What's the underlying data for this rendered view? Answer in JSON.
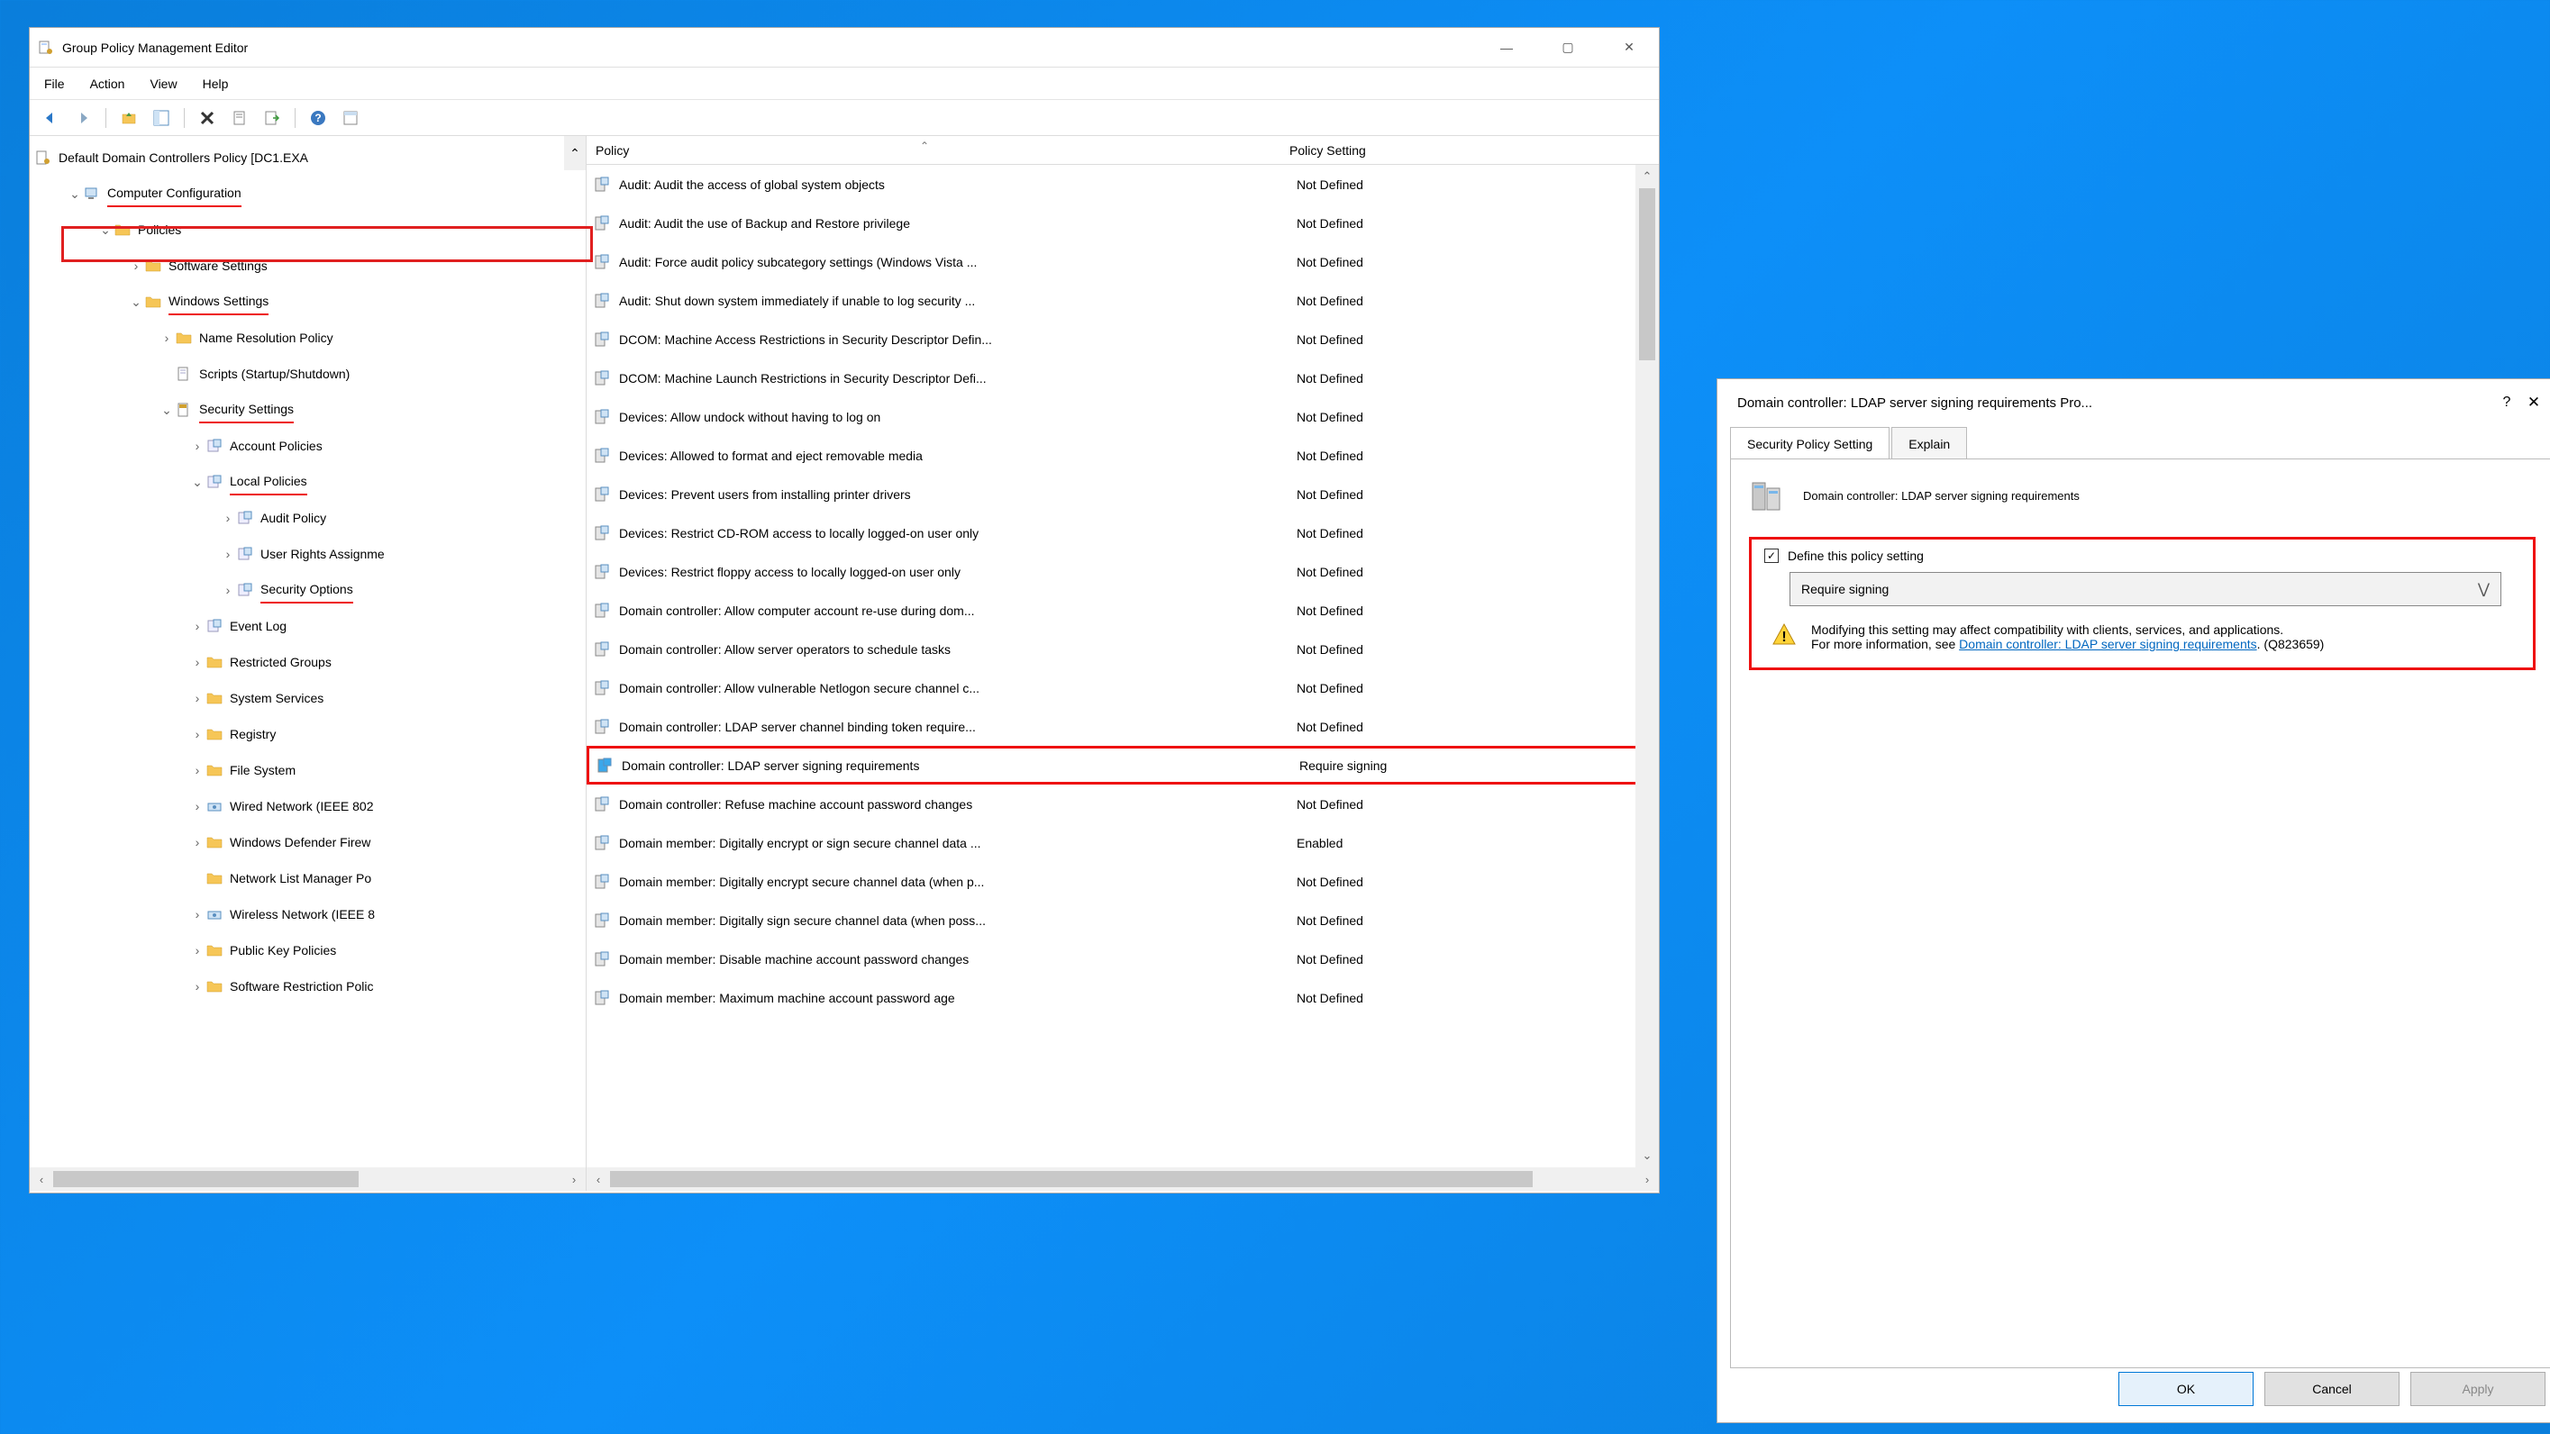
{
  "main": {
    "title": "Group Policy Management Editor",
    "menu": [
      "File",
      "Action",
      "View",
      "Help"
    ],
    "rootNode": "Default Domain Controllers Policy [DC1.EXA",
    "tree": [
      {
        "indent": 1,
        "chev": "▾",
        "icon": "computer",
        "label": "Computer Configuration",
        "u": true
      },
      {
        "indent": 2,
        "chev": "▾",
        "icon": "folder",
        "label": "Policies"
      },
      {
        "indent": 3,
        "chev": "›",
        "icon": "folder",
        "label": "Software Settings"
      },
      {
        "indent": 3,
        "chev": "▾",
        "icon": "folder",
        "label": "Windows Settings",
        "u": true
      },
      {
        "indent": 4,
        "chev": "›",
        "icon": "folder",
        "label": "Name Resolution Policy"
      },
      {
        "indent": 4,
        "chev": "",
        "icon": "doc",
        "label": "Scripts (Startup/Shutdown)"
      },
      {
        "indent": 4,
        "chev": "▾",
        "icon": "shield",
        "label": "Security Settings",
        "u": true
      },
      {
        "indent": 5,
        "chev": "›",
        "icon": "policy",
        "label": "Account Policies"
      },
      {
        "indent": 5,
        "chev": "▾",
        "icon": "policy",
        "label": "Local Policies",
        "u": true
      },
      {
        "indent": 6,
        "chev": "›",
        "icon": "policy",
        "label": "Audit Policy"
      },
      {
        "indent": 6,
        "chev": "›",
        "icon": "policy",
        "label": "User Rights Assignme"
      },
      {
        "indent": 6,
        "chev": "›",
        "icon": "policy",
        "label": "Security Options",
        "u": true,
        "sel": true
      },
      {
        "indent": 5,
        "chev": "›",
        "icon": "policy",
        "label": "Event Log"
      },
      {
        "indent": 5,
        "chev": "›",
        "icon": "folder",
        "label": "Restricted Groups"
      },
      {
        "indent": 5,
        "chev": "›",
        "icon": "folder",
        "label": "System Services"
      },
      {
        "indent": 5,
        "chev": "›",
        "icon": "folder",
        "label": "Registry"
      },
      {
        "indent": 5,
        "chev": "›",
        "icon": "folder",
        "label": "File System"
      },
      {
        "indent": 5,
        "chev": "›",
        "icon": "net",
        "label": "Wired Network (IEEE 802"
      },
      {
        "indent": 5,
        "chev": "›",
        "icon": "folder",
        "label": "Windows Defender Firew"
      },
      {
        "indent": 5,
        "chev": "",
        "icon": "folder",
        "label": "Network List Manager Po"
      },
      {
        "indent": 5,
        "chev": "›",
        "icon": "net",
        "label": "Wireless Network (IEEE 8"
      },
      {
        "indent": 5,
        "chev": "›",
        "icon": "folder",
        "label": "Public Key Policies"
      },
      {
        "indent": 5,
        "chev": "›",
        "icon": "folder",
        "label": "Software Restriction Polic"
      }
    ],
    "listHeader": {
      "col1": "Policy",
      "col2": "Policy Setting"
    },
    "policies": [
      {
        "name": "Audit: Audit the access of global system objects",
        "value": "Not Defined"
      },
      {
        "name": "Audit: Audit the use of Backup and Restore privilege",
        "value": "Not Defined"
      },
      {
        "name": "Audit: Force audit policy subcategory settings (Windows Vista ...",
        "value": "Not Defined"
      },
      {
        "name": "Audit: Shut down system immediately if unable to log security ...",
        "value": "Not Defined"
      },
      {
        "name": "DCOM: Machine Access Restrictions in Security Descriptor Defin...",
        "value": "Not Defined"
      },
      {
        "name": "DCOM: Machine Launch Restrictions in Security Descriptor Defi...",
        "value": "Not Defined"
      },
      {
        "name": "Devices: Allow undock without having to log on",
        "value": "Not Defined"
      },
      {
        "name": "Devices: Allowed to format and eject removable media",
        "value": "Not Defined"
      },
      {
        "name": "Devices: Prevent users from installing printer drivers",
        "value": "Not Defined"
      },
      {
        "name": "Devices: Restrict CD-ROM access to locally logged-on user only",
        "value": "Not Defined"
      },
      {
        "name": "Devices: Restrict floppy access to locally logged-on user only",
        "value": "Not Defined"
      },
      {
        "name": "Domain controller: Allow computer account re-use during dom...",
        "value": "Not Defined"
      },
      {
        "name": "Domain controller: Allow server operators to schedule tasks",
        "value": "Not Defined"
      },
      {
        "name": "Domain controller: Allow vulnerable Netlogon secure channel c...",
        "value": "Not Defined"
      },
      {
        "name": "Domain controller: LDAP server channel binding token require...",
        "value": "Not Defined"
      },
      {
        "name": "Domain controller: LDAP server signing requirements",
        "value": "Require signing",
        "hl": true
      },
      {
        "name": "Domain controller: Refuse machine account password changes",
        "value": "Not Defined"
      },
      {
        "name": "Domain member: Digitally encrypt or sign secure channel data ...",
        "value": "Enabled"
      },
      {
        "name": "Domain member: Digitally encrypt secure channel data (when p...",
        "value": "Not Defined"
      },
      {
        "name": "Domain member: Digitally sign secure channel data (when poss...",
        "value": "Not Defined"
      },
      {
        "name": "Domain member: Disable machine account password changes",
        "value": "Not Defined"
      },
      {
        "name": "Domain member: Maximum machine account password age",
        "value": "Not Defined"
      }
    ]
  },
  "dialog": {
    "title": "Domain controller: LDAP server signing requirements Pro...",
    "tabs": [
      "Security Policy Setting",
      "Explain"
    ],
    "policyName": "Domain controller: LDAP server signing requirements",
    "defineLabel": "Define this policy setting",
    "dropdownValue": "Require signing",
    "warnText": "Modifying this setting may affect compatibility with clients, services, and applications.",
    "warnMore": "For more information, see ",
    "warnLink": "Domain controller: LDAP server signing requirements",
    "warnKB": ". (Q823659)",
    "buttons": {
      "ok": "OK",
      "cancel": "Cancel",
      "apply": "Apply"
    }
  }
}
